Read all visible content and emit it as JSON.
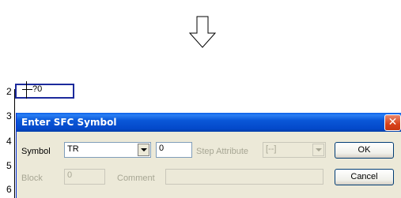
{
  "arrow_icon": "down-arrow-icon",
  "ladder": {
    "row_numbers": [
      "2",
      "3",
      "4",
      "5",
      "6"
    ],
    "cursor_text": "?0"
  },
  "dialog": {
    "title": "Enter SFC Symbol",
    "close_label": "✕",
    "symbol_label": "Symbol",
    "symbol_value": "TR",
    "number_value": "0",
    "step_attribute_label": "Step Attribute",
    "step_attribute_value": "[--]",
    "ok_label": "OK",
    "block_label": "Block",
    "block_value": "0",
    "comment_label": "Comment",
    "comment_value": "",
    "cancel_label": "Cancel"
  },
  "colors": {
    "titlebar": "#0a57d8",
    "close": "#d8421a",
    "dialog_bg": "#ece9d8",
    "cursor_border": "#1c2a9c"
  }
}
